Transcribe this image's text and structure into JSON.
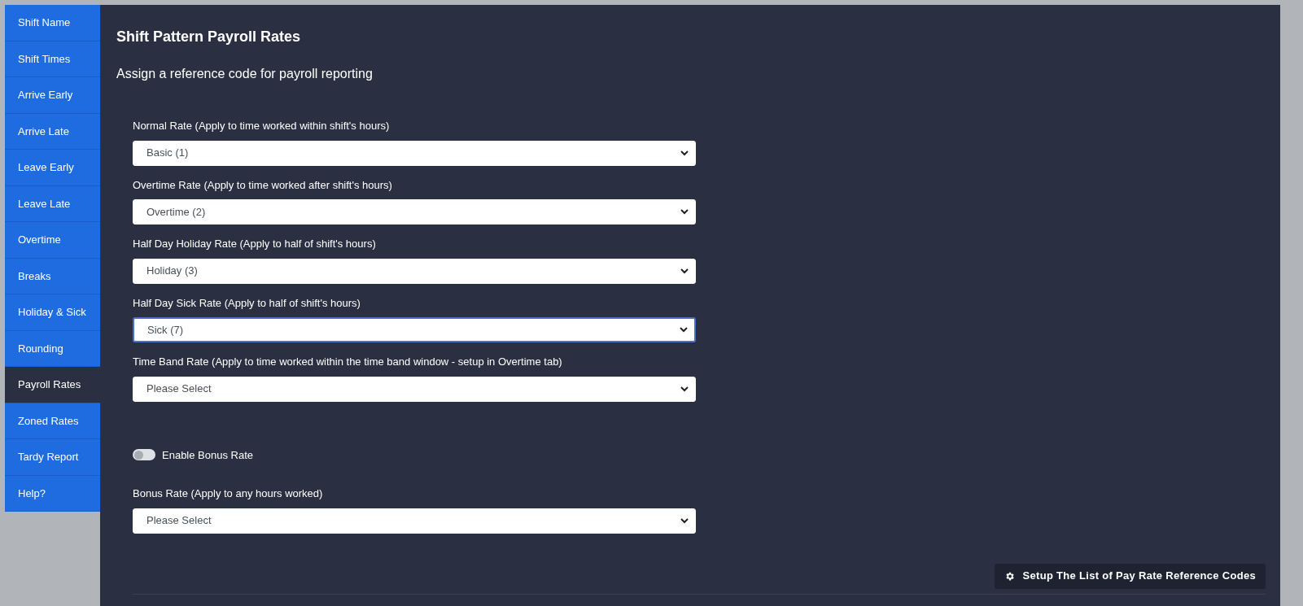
{
  "sidebar": {
    "items": [
      {
        "label": "Shift Name",
        "selected": false
      },
      {
        "label": "Shift Times",
        "selected": false
      },
      {
        "label": "Arrive Early",
        "selected": false
      },
      {
        "label": "Arrive Late",
        "selected": false
      },
      {
        "label": "Leave Early",
        "selected": false
      },
      {
        "label": "Leave Late",
        "selected": false
      },
      {
        "label": "Overtime",
        "selected": false
      },
      {
        "label": "Breaks",
        "selected": false
      },
      {
        "label": "Holiday & Sick",
        "selected": false
      },
      {
        "label": "Rounding",
        "selected": false
      },
      {
        "label": "Payroll Rates",
        "selected": true
      },
      {
        "label": "Zoned Rates",
        "selected": false
      },
      {
        "label": "Tardy Report",
        "selected": false
      },
      {
        "label": "Help?",
        "selected": false
      }
    ]
  },
  "title": "Shift Pattern Payroll Rates",
  "subtitle": "Assign a reference code for payroll reporting",
  "rate_fields": [
    {
      "label": "Normal Rate (Apply to time worked within shift's hours)",
      "value": "Basic (1)",
      "focused": false
    },
    {
      "label": "Overtime Rate (Apply to time worked after shift's hours)",
      "value": "Overtime (2)",
      "focused": false
    },
    {
      "label": "Half Day Holiday Rate (Apply to half of shift's hours)",
      "value": "Holiday (3)",
      "focused": false
    },
    {
      "label": "Half Day Sick Rate (Apply to half of shift's hours)",
      "value": "Sick (7)",
      "focused": true
    },
    {
      "label": "Time Band Rate (Apply to time worked within the time band window - setup in Overtime tab)",
      "value": "Please Select",
      "focused": false
    }
  ],
  "bonus_toggle": {
    "label": "Enable Bonus Rate",
    "on": false
  },
  "bonus_field": {
    "label": "Bonus Rate (Apply to any hours worked)",
    "value": "Please Select",
    "focused": false
  },
  "setup_button": {
    "label": "Setup The List of Pay Rate Reference Codes"
  }
}
